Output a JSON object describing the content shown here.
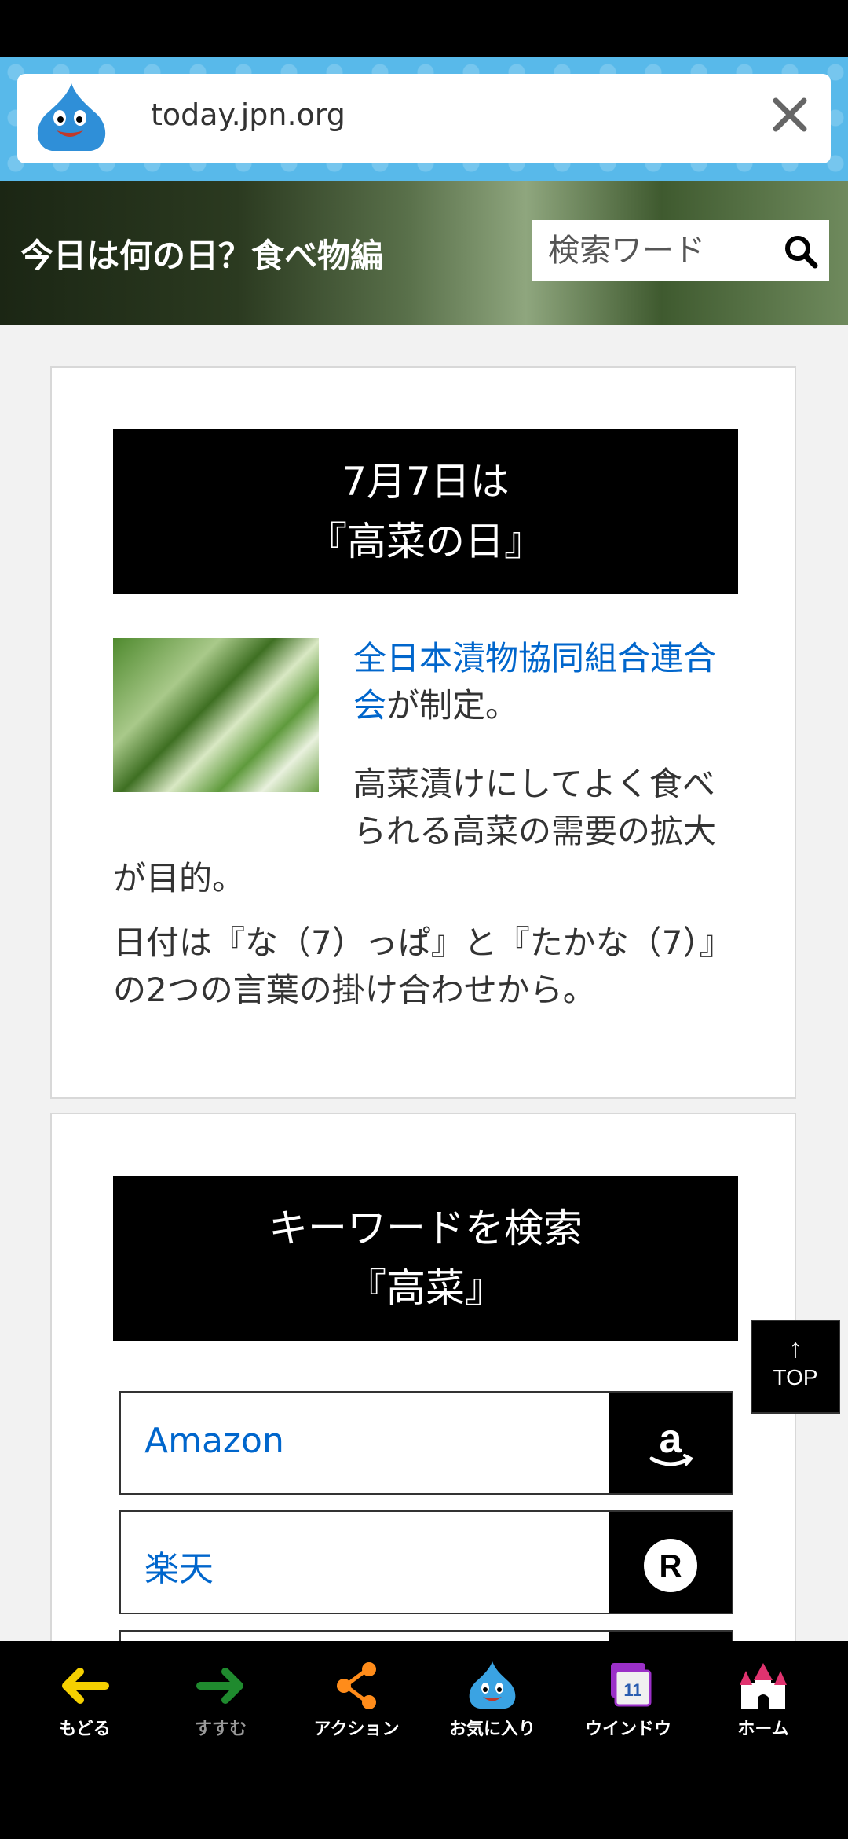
{
  "browser": {
    "url": "today.jpn.org"
  },
  "hero": {
    "title": "今日は何の日？食べ物編",
    "search_placeholder": "検索ワード"
  },
  "article": {
    "heading_line1": "7月7日は",
    "heading_line2": "『高菜の日』",
    "link_text": "全日本漬物協同組合連合会",
    "link_suffix": "が制定。",
    "para2_line1": "高菜漬けにしてよく食べ",
    "para2_line2": "られる高菜の需要の拡大",
    "para2_line3": "が目的。",
    "para3": "日付は『な（7）っぱ』と『たかな（7）』の2つの言葉の掛け合わせから。",
    "image_name": "高菜"
  },
  "keyword_search": {
    "heading_line1": "キーワードを検索",
    "heading_line2": "『高菜』",
    "shops": [
      {
        "label": "Amazon",
        "icon": "amazon-icon"
      },
      {
        "label": "楽天",
        "icon": "rakuten-icon"
      }
    ]
  },
  "top_button": {
    "arrow": "↑",
    "label": "TOP"
  },
  "bottom_nav": {
    "items": [
      {
        "label": "もどる",
        "icon": "back-arrow-icon",
        "color": "#f5d000"
      },
      {
        "label": "すすむ",
        "icon": "forward-arrow-icon",
        "color": "#1f8a2e"
      },
      {
        "label": "アクション",
        "icon": "share-icon",
        "color": "#ff8c1a"
      },
      {
        "label": "お気に入り",
        "icon": "slime-icon",
        "color": "#3aa3e3"
      },
      {
        "label": "ウインドウ",
        "icon": "window-icon",
        "badge": "11",
        "color": "#9b30c8"
      },
      {
        "label": "ホーム",
        "icon": "castle-icon",
        "color": "#e0336f"
      }
    ]
  },
  "colors": {
    "link": "#0066cc",
    "urlbar": "#58b9ea"
  }
}
